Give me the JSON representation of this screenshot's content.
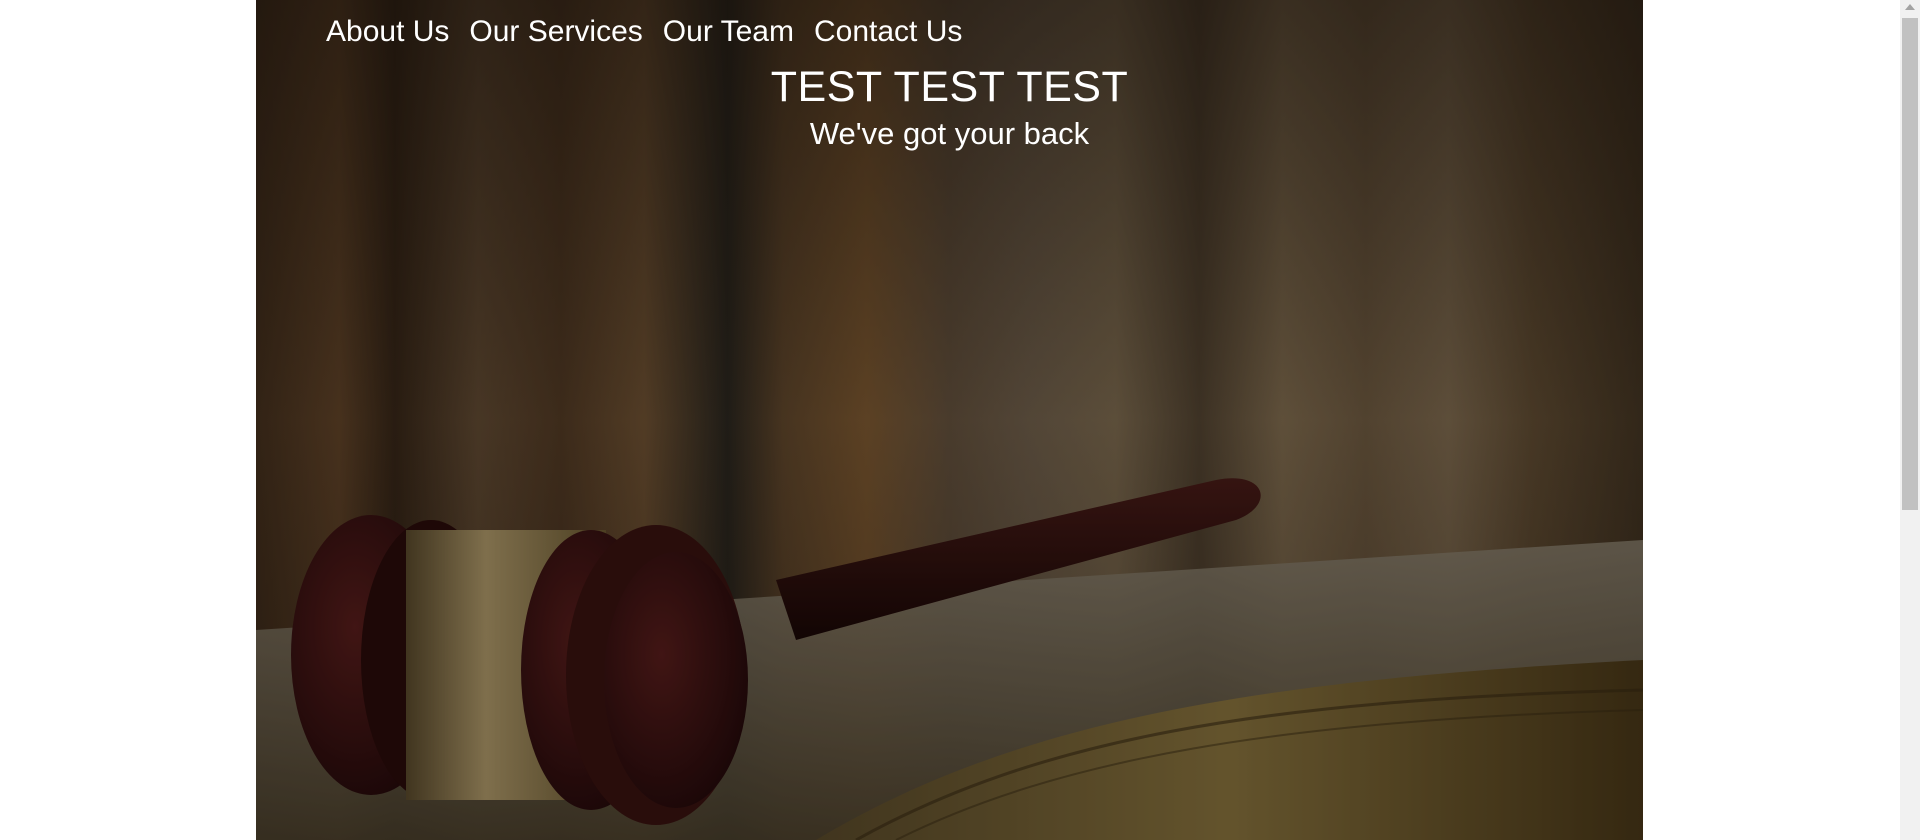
{
  "nav": {
    "items": [
      {
        "label": "About Us"
      },
      {
        "label": "Our Services"
      },
      {
        "label": "Our Team"
      },
      {
        "label": "Contact Us"
      }
    ]
  },
  "hero": {
    "title": "TEST TEST TEST",
    "tagline": "We've got your back",
    "image": "gavel-on-open-book-with-law-books-background"
  },
  "colors": {
    "text": "#ffffff",
    "page_background": "#ffffff",
    "scrollbar_track": "#f1f1f1",
    "scrollbar_thumb": "#c1c1c1"
  }
}
